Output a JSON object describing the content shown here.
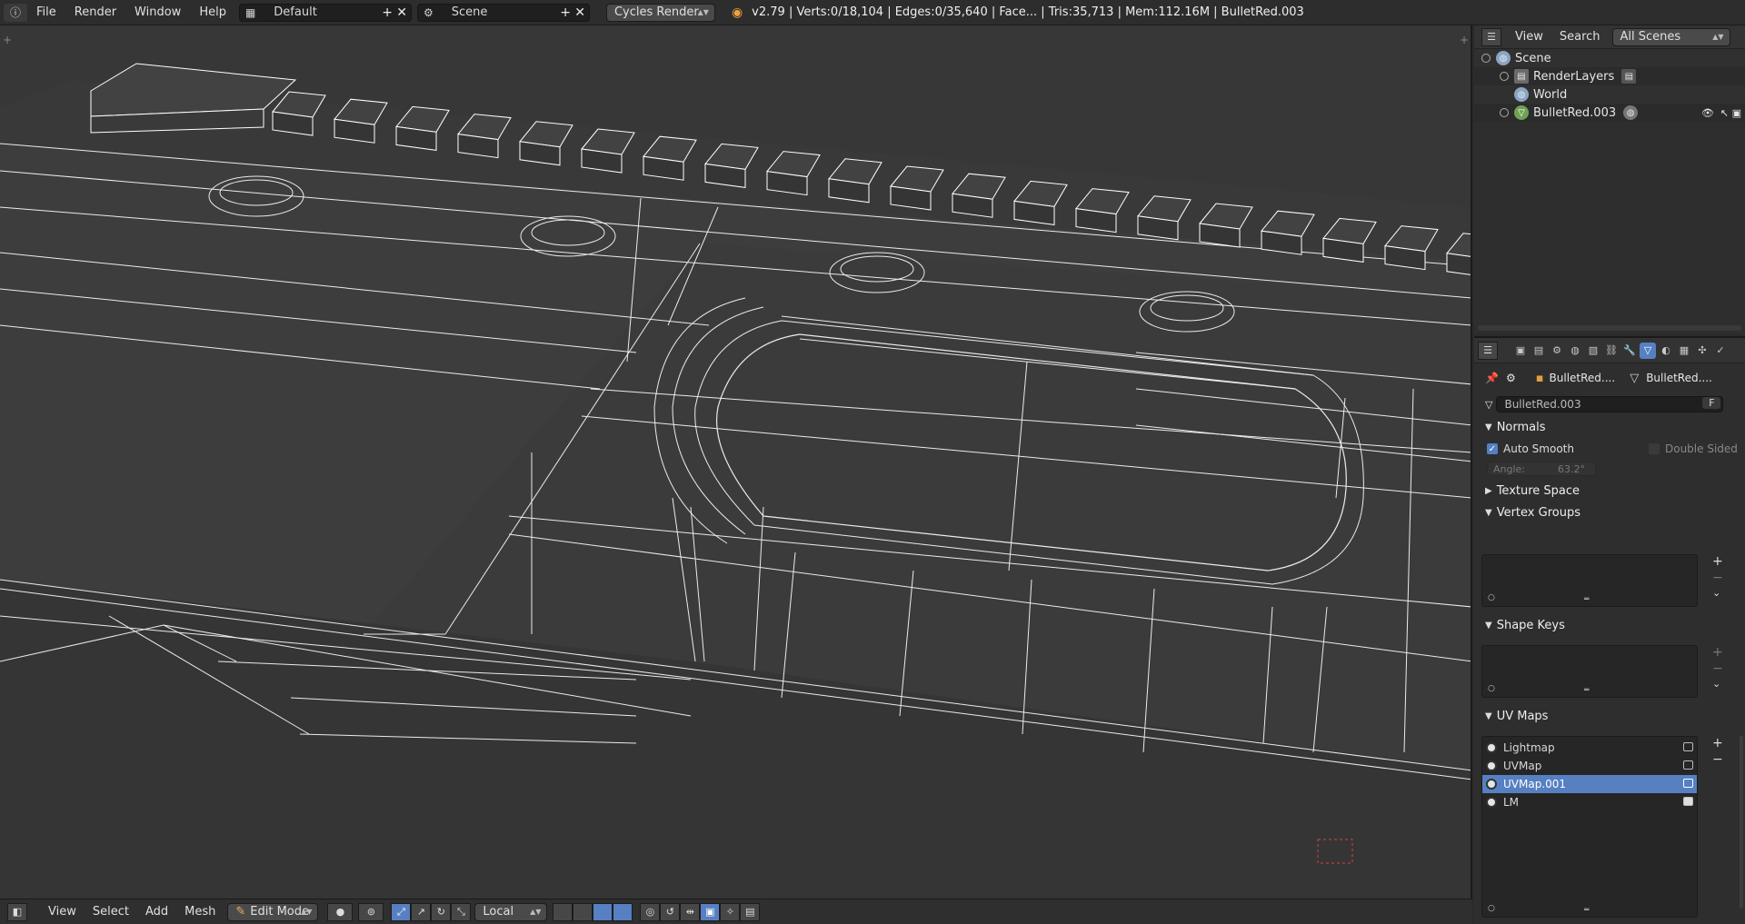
{
  "topbar": {
    "info_icon": "info-icon",
    "menus": [
      "File",
      "Render",
      "Window",
      "Help"
    ],
    "screen_layout": "Default",
    "scene": "Scene",
    "render_engine": "Cycles Render",
    "stats": "v2.79 | Verts:0/18,104 | Edges:0/35,640 | Face... | Tris:35,713 | Mem:112.16M | BulletRed.003"
  },
  "viewport_header": {
    "menus": [
      "View",
      "Select",
      "Add",
      "Mesh"
    ],
    "mode": "Edit Mode",
    "pivot": "Local"
  },
  "outliner": {
    "menus": [
      "View",
      "Search"
    ],
    "filter": "All Scenes",
    "items": [
      {
        "label": "Scene",
        "icon": "scene-icon"
      },
      {
        "label": "RenderLayers",
        "icon": "renderlayers-icon"
      },
      {
        "label": "World",
        "icon": "world-icon"
      },
      {
        "label": "BulletRed.003",
        "icon": "mesh-object-icon"
      }
    ]
  },
  "properties": {
    "breadcrumb_object": "BulletRed....",
    "breadcrumb_mesh": "BulletRed....",
    "mesh_name": "BulletRed.003",
    "fake_user": "F",
    "normals": {
      "title": "Normals",
      "auto_smooth_label": "Auto Smooth",
      "auto_smooth": true,
      "double_sided_label": "Double Sided",
      "double_sided": false,
      "angle_label": "Angle:",
      "angle_value": "63.2°"
    },
    "texture_space": "Texture Space",
    "vertex_groups": "Vertex Groups",
    "shape_keys": "Shape Keys",
    "uv_maps": {
      "title": "UV Maps",
      "items": [
        "Lightmap",
        "UVMap",
        "UVMap.001",
        "LM"
      ],
      "selected_index": 2
    }
  },
  "colors": {
    "accent": "#5680c2",
    "viewport_bg": "#393939",
    "wire": "#ffffff"
  }
}
